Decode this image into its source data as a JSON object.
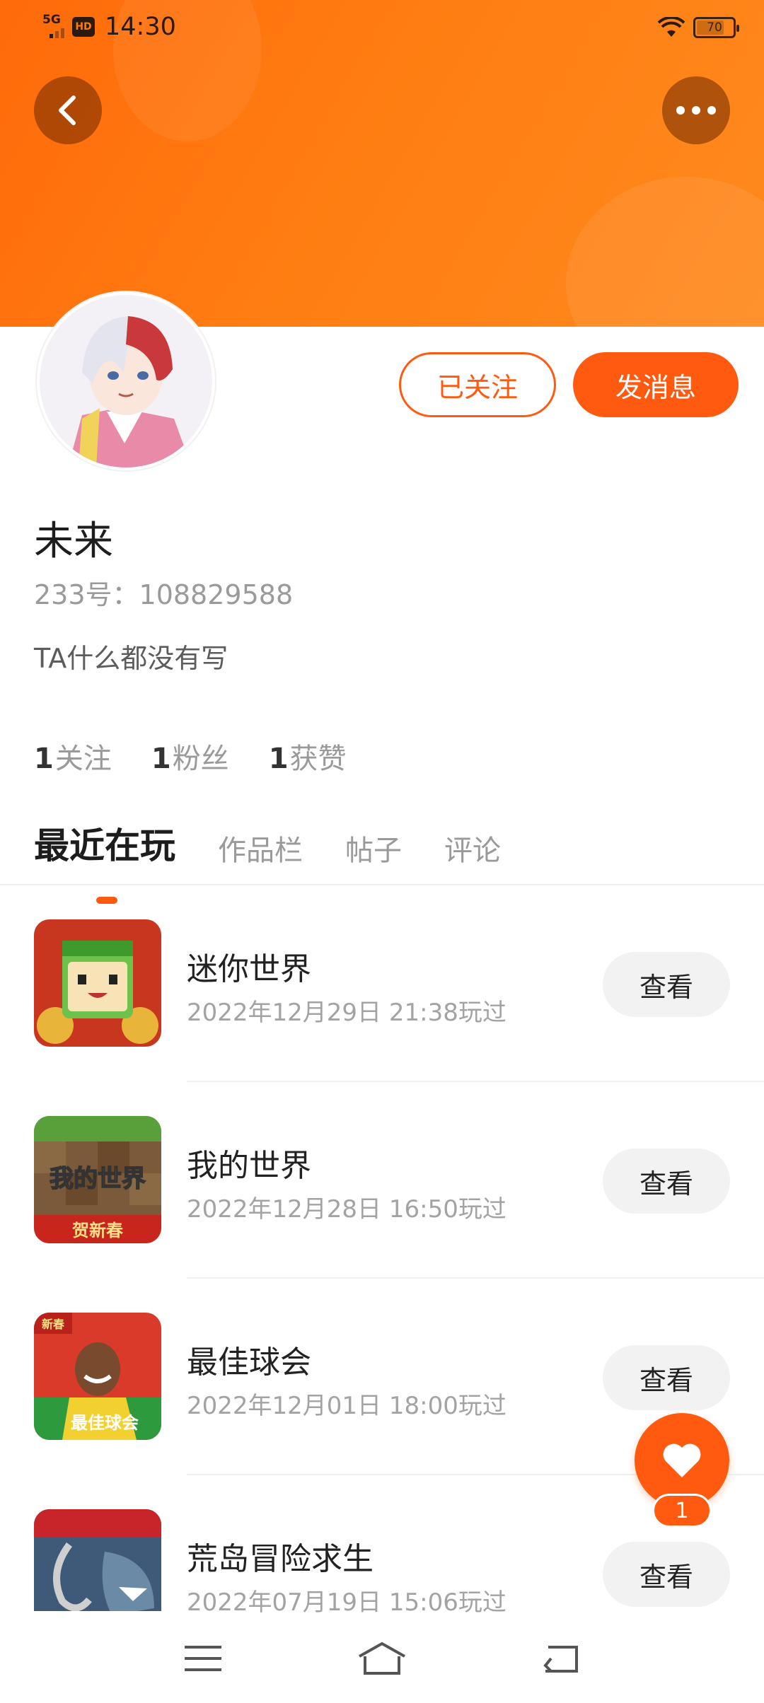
{
  "status_bar": {
    "network": "5G",
    "hd": "HD",
    "time": "14:30",
    "battery": "70"
  },
  "profile": {
    "name": "未来",
    "id_line": "233号：108829588",
    "bio": "TA什么都没有写",
    "followed_label": "已关注",
    "message_label": "发消息"
  },
  "stats": [
    {
      "num": "1",
      "label": "关注"
    },
    {
      "num": "1",
      "label": "粉丝"
    },
    {
      "num": "1",
      "label": "获赞"
    }
  ],
  "tabs": [
    "最近在玩",
    "作品栏",
    "帖子",
    "评论"
  ],
  "games": [
    {
      "title": "迷你世界",
      "time": "2022年12月29日 21:38玩过",
      "action": "查看"
    },
    {
      "title": "我的世界",
      "time": "2022年12月28日 16:50玩过",
      "action": "查看"
    },
    {
      "title": "最佳球会",
      "time": "2022年12月01日 18:00玩过",
      "action": "查看"
    },
    {
      "title": "荒岛冒险求生",
      "time": "2022年07月19日 15:06玩过",
      "action": "查看"
    }
  ],
  "icon_text": {
    "minecraft_title": "我的世界",
    "minecraft_banner": "贺新春",
    "soccer_badge": "新春",
    "soccer_title": "最佳球会"
  },
  "like": {
    "count": "1"
  },
  "colors": {
    "accent": "#ff5a10",
    "hero": "#ff7d12"
  },
  "icons": [
    "back-arrow-icon",
    "more-dots-icon",
    "heart-icon",
    "menu-icon",
    "home-icon",
    "return-icon"
  ]
}
